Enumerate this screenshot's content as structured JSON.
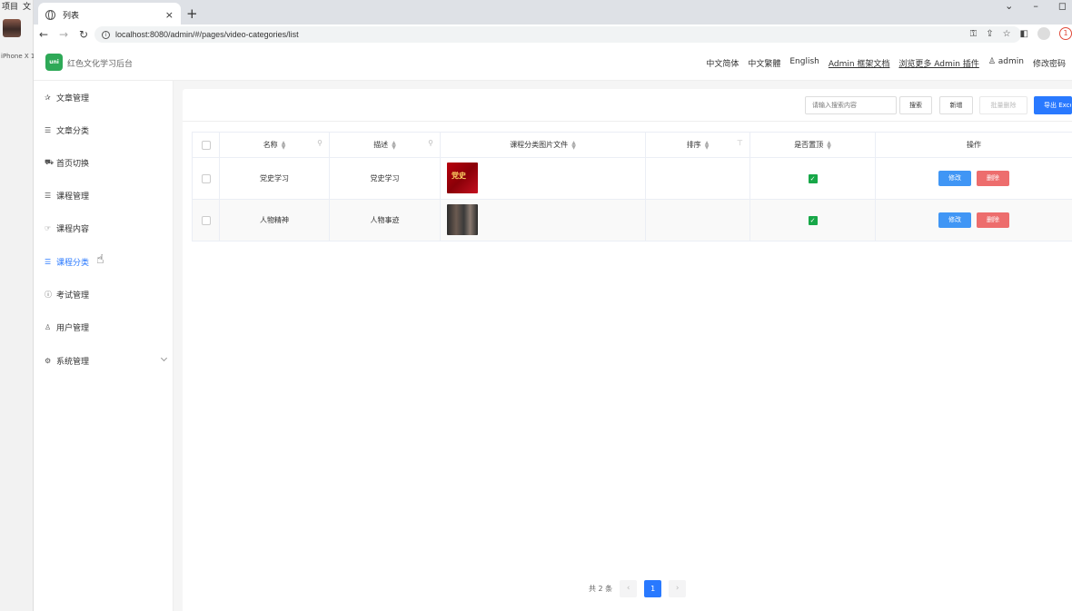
{
  "desktop": {
    "menu": [
      "项目",
      "文"
    ],
    "device_label": "iPhone X 1"
  },
  "browser": {
    "tab_title": "列表",
    "tab_close": "×",
    "new_tab": "+",
    "url": "localhost:8080/admin/#/pages/video-categories/list",
    "update_badge": "1"
  },
  "header": {
    "logo_text": "uni",
    "title": "红色文化学习后台",
    "links": [
      "中文简体",
      "中文繁體",
      "English",
      "Admin 框架文档",
      "浏览更多 Admin 插件",
      "admin",
      "修改密码"
    ]
  },
  "sidebar": {
    "items": [
      {
        "label": "文章管理",
        "icon": "✰"
      },
      {
        "label": "文章分类",
        "icon": "☰"
      },
      {
        "label": "首页切换",
        "icon": "⛟"
      },
      {
        "label": "课程管理",
        "icon": "☰"
      },
      {
        "label": "课程内容",
        "icon": "☞"
      },
      {
        "label": "课程分类",
        "icon": "☰"
      },
      {
        "label": "考试管理",
        "icon": "ⓘ"
      },
      {
        "label": "用户管理",
        "icon": "♙"
      },
      {
        "label": "系统管理",
        "icon": "⚙"
      }
    ]
  },
  "toolbar": {
    "search_placeholder": "请输入搜索内容",
    "search_label": "搜索",
    "add_label": "新增",
    "batch_delete_label": "批量删除",
    "export_label": "导出 Excel"
  },
  "table": {
    "columns": [
      "名称",
      "描述",
      "课程分类图片文件",
      "排序",
      "是否置顶",
      "操作"
    ],
    "rows": [
      {
        "name": "党史学习",
        "desc": "党史学习",
        "sort": "",
        "is_top": true
      },
      {
        "name": "人物精神",
        "desc": "人物事迹",
        "sort": "",
        "is_top": true
      }
    ],
    "edit_label": "修改",
    "delete_label": "删除"
  },
  "pager": {
    "total_text": "共 2 条",
    "prev": "‹",
    "current": "1",
    "next": "›"
  }
}
